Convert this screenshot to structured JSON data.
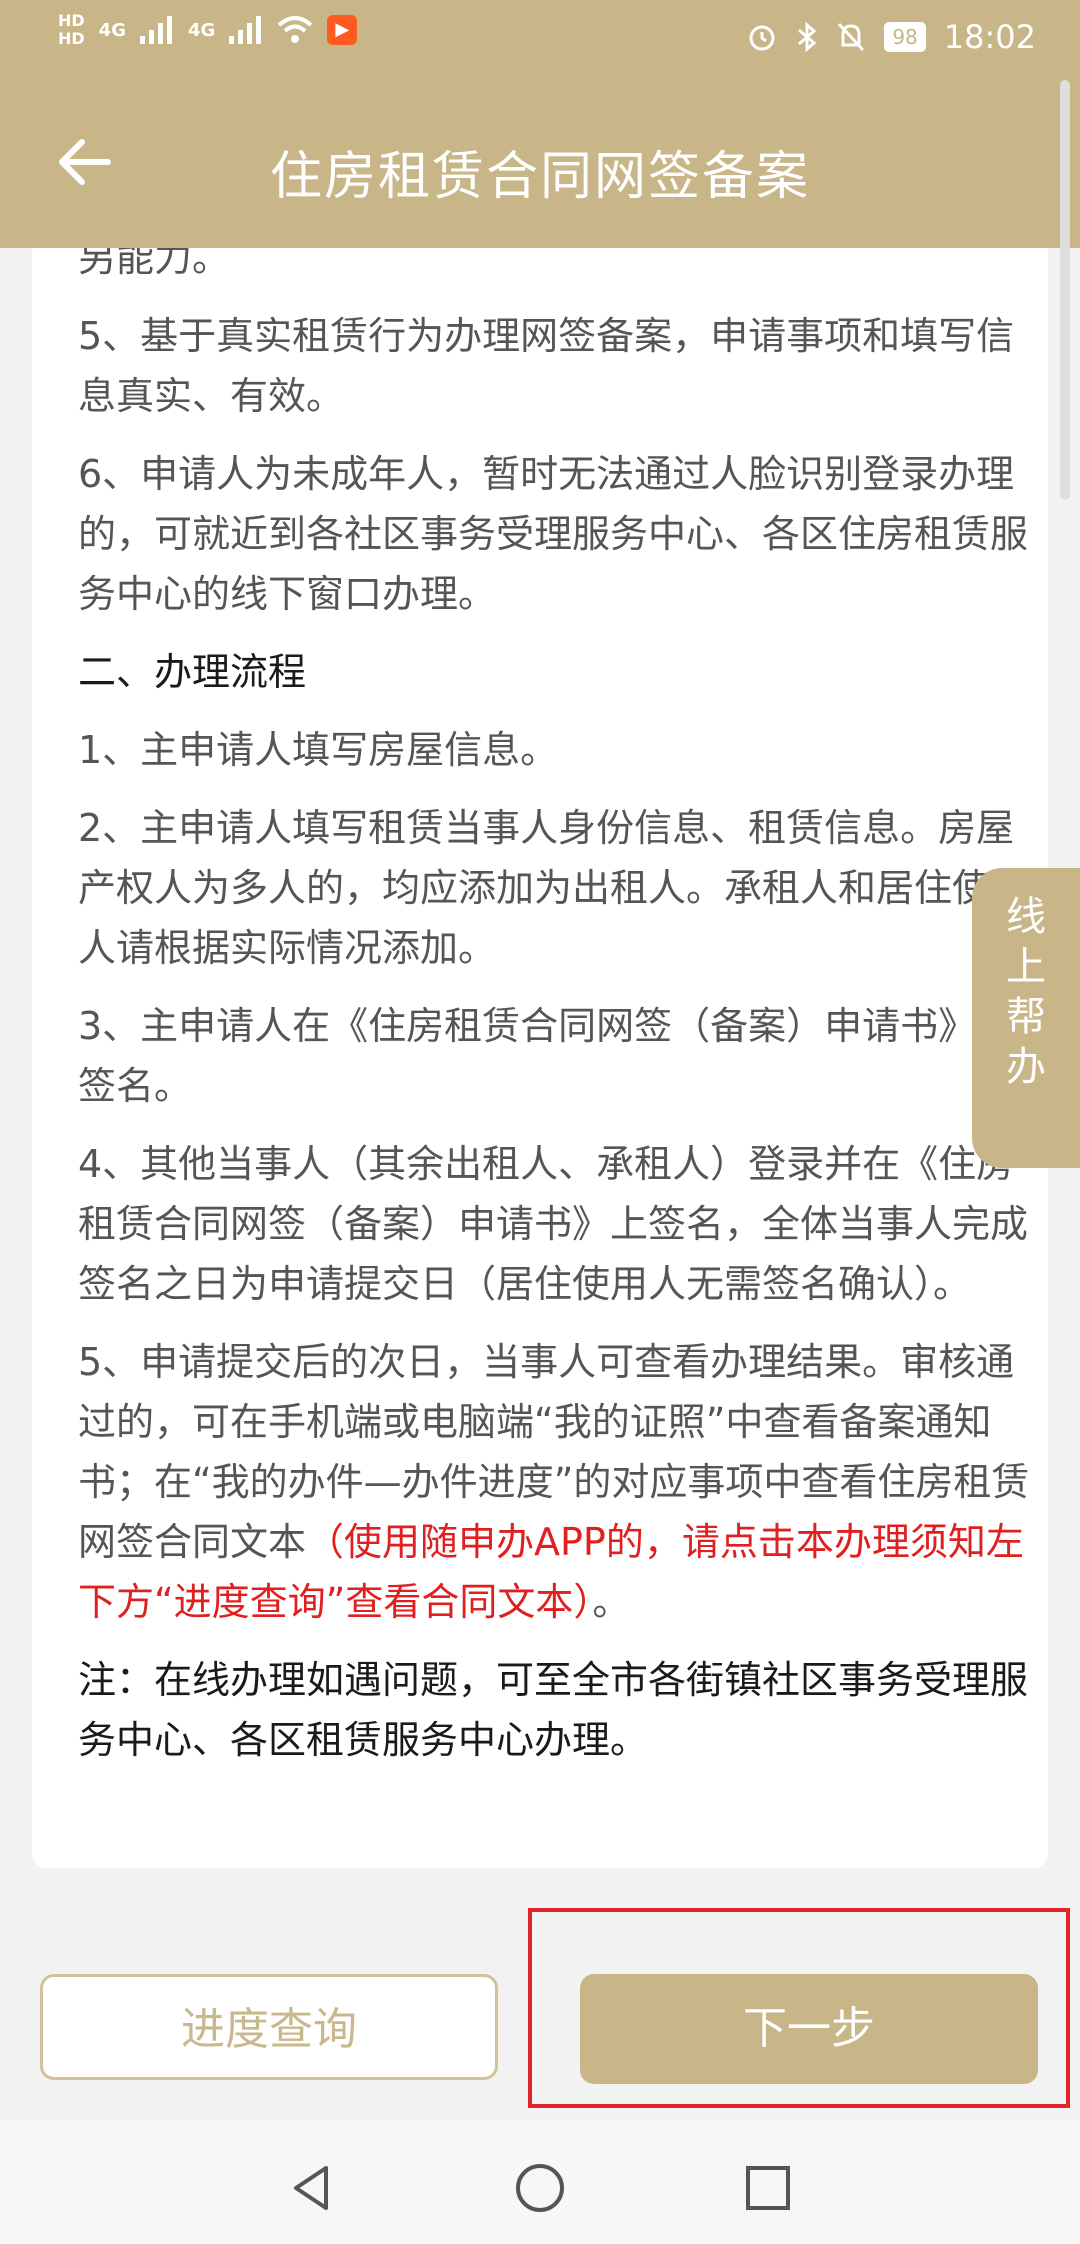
{
  "status_bar": {
    "hd_top": "HD",
    "hd_bottom": "HD",
    "sim1": "4G",
    "sim2": "4G",
    "battery": "98",
    "time": "18:02"
  },
  "header": {
    "title": "住房租赁合同网签备案",
    "back_icon": "arrow-left-icon"
  },
  "content": {
    "paragraphs": [
      "另能力。",
      "5、基于真实租赁行为办理网签备案，申请事项和填写信息真实、有效。",
      "6、申请人为未成年人，暂时无法通过人脸识别登录办理的，可就近到各社区事务受理服务中心、各区住房租赁服务中心的线下窗口办理。"
    ],
    "section_heading": "二、办理流程",
    "steps": [
      "1、主申请人填写房屋信息。",
      "2、主申请人填写租赁当事人身份信息、租赁信息。房屋产权人为多人的，均应添加为出租人。承租人和居住使用人请根据实际情况添加。",
      "3、主申请人在《住房租赁合同网签（备案）申请书》上签名。",
      "4、其他当事人（其余出租人、承租人）登录并在《住房租赁合同网签（备案）申请书》上签名，全体当事人完成签名之日为申请提交日（居住使用人无需签名确认）。"
    ],
    "step5_text": "5、申请提交后的次日，当事人可查看办理结果。审核通过的，可在手机端或电脑端“我的证照”中查看备案通知书；在“我的办件—办件进度”的对应事项中查看住房租赁网签合同文本",
    "step5_red": "（使用随申办APP的，请点击本办理须知左下方“进度查询”查看合同文本）",
    "step5_end": "。",
    "note": "注：在线办理如遇问题，可至全市各街镇社区事务受理服务中心、各区租赁服务中心办理。"
  },
  "help_tab": {
    "label": "线上帮办"
  },
  "buttons": {
    "progress": "进度查询",
    "next": "下一步"
  },
  "colors": {
    "brand": "#c8b588",
    "highlight": "#e02020"
  }
}
